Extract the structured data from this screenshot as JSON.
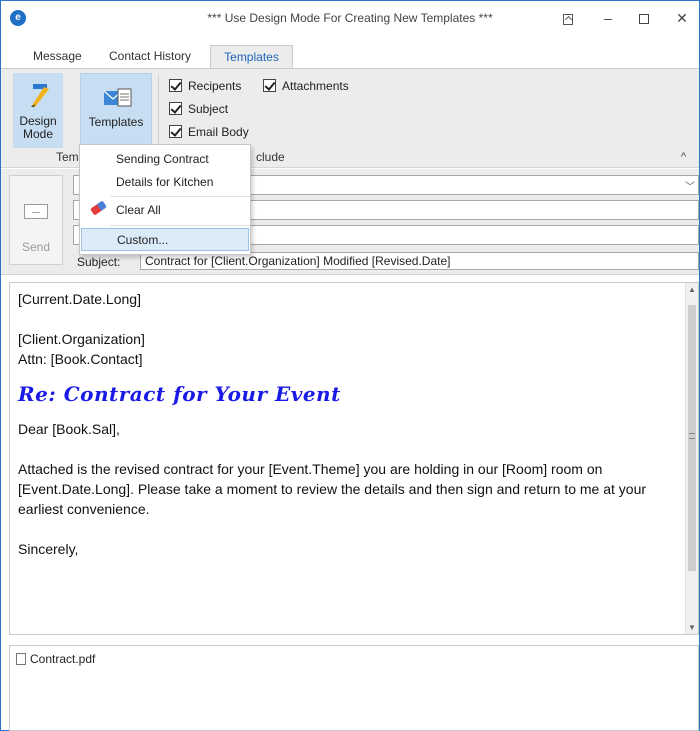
{
  "window": {
    "title": "*** Use Design Mode For Creating New Templates ***",
    "app_icon": "app-logo-icon"
  },
  "tabs": [
    {
      "label": "Message"
    },
    {
      "label": "Contact History"
    },
    {
      "label": "Templates",
      "active": true
    }
  ],
  "ribbon": {
    "design_mode_label_1": "Design",
    "design_mode_label_2": "Mode",
    "templates_label": "Templates",
    "checkboxes": [
      {
        "label": "Recipents",
        "checked": true
      },
      {
        "label": "Subject",
        "checked": true
      },
      {
        "label": "Email Body",
        "checked": true
      },
      {
        "label": "Attachments",
        "checked": true
      }
    ],
    "group_templates_visible": "Tem",
    "group_include_visible": "clude"
  },
  "templates_menu": {
    "items": [
      {
        "label": "Sending Contract"
      },
      {
        "label": "Details for Kitchen"
      },
      {
        "label": "Clear All",
        "icon": "eraser-icon"
      },
      {
        "label": "Custom...",
        "highlighted": true
      }
    ]
  },
  "header": {
    "send_label": "Send",
    "subject_label": "Subject:",
    "subject_value": "Contract for [Client.Organization] Modified [Revised.Date]"
  },
  "body": {
    "line_date": "[Current.Date.Long]",
    "line_org": "[Client.Organization]",
    "line_attn": "Attn:  [Book.Contact]",
    "re_line": "Re:  Contract for Your Event",
    "salutation": "Dear [Book.Sal],",
    "paragraph": "Attached is the revised contract for your [Event.Theme] you are holding in our [Room] room on [Event.Date.Long].  Please take a moment to review the details and then sign and return to me at your earliest convenience.",
    "closing": "Sincerely,"
  },
  "attachments": [
    {
      "name": "Contract.pdf"
    }
  ],
  "colors": {
    "accent": "#1c64b8",
    "re_line": "#1a1ae6",
    "menu_highlight": "#dcebf8"
  }
}
